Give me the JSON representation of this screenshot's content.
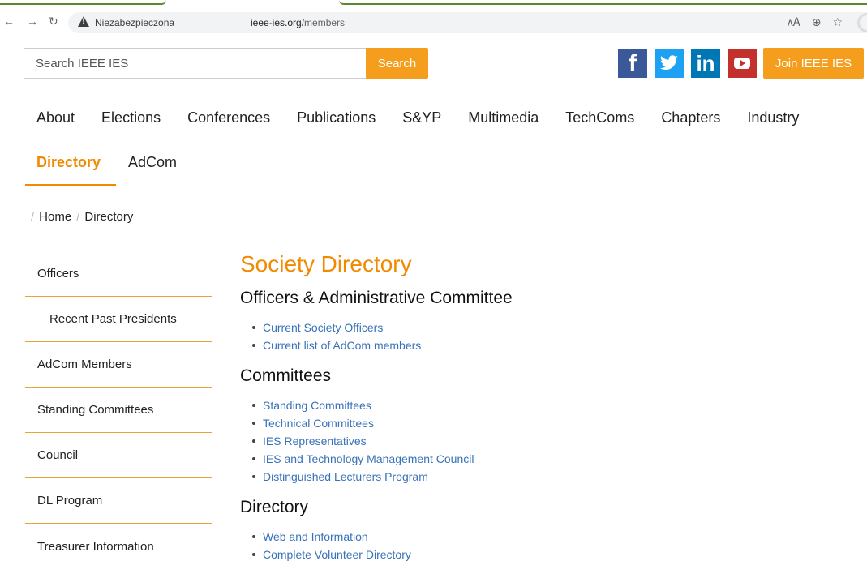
{
  "browser": {
    "security_label": "Niezabezpieczona",
    "url_domain": "ieee-ies.org",
    "url_path": "/members",
    "icons": [
      "back-icon",
      "forward-icon",
      "reload-icon",
      "translate-icon",
      "zoom-icon",
      "bookmark-star-icon"
    ]
  },
  "header": {
    "search_placeholder": "Search IEEE IES",
    "search_button": "Search",
    "join_button": "Join IEEE IES",
    "social": [
      "facebook",
      "twitter",
      "linkedin",
      "youtube"
    ]
  },
  "nav": {
    "row1": [
      "About",
      "Elections",
      "Conferences",
      "Publications",
      "S&YP",
      "Multimedia",
      "TechComs",
      "Chapters",
      "Industry"
    ],
    "row2": [
      "Directory",
      "AdCom"
    ],
    "active": "Directory"
  },
  "breadcrumb": [
    "Home",
    "Directory"
  ],
  "sidebar": [
    "Officers",
    "Recent Past Presidents",
    "AdCom Members",
    "Standing Committees",
    "Council",
    "DL Program",
    "Treasurer Information"
  ],
  "content": {
    "title": "Society Directory",
    "sections": [
      {
        "heading": "Officers & Administrative Committee",
        "links": [
          "Current Society Officers",
          "Current list of AdCom members"
        ]
      },
      {
        "heading": "Committees",
        "links": [
          "Standing Committees",
          "Technical Committees",
          "IES Representatives",
          "IES and Technology Management Council",
          "Distinguished Lecturers Program"
        ]
      },
      {
        "heading": "Directory",
        "links": [
          "Web and Information",
          "Complete Volunteer Directory"
        ]
      }
    ]
  },
  "colors": {
    "accent": "#f59e1d",
    "active_text": "#f08a00",
    "link": "#3872b8"
  }
}
